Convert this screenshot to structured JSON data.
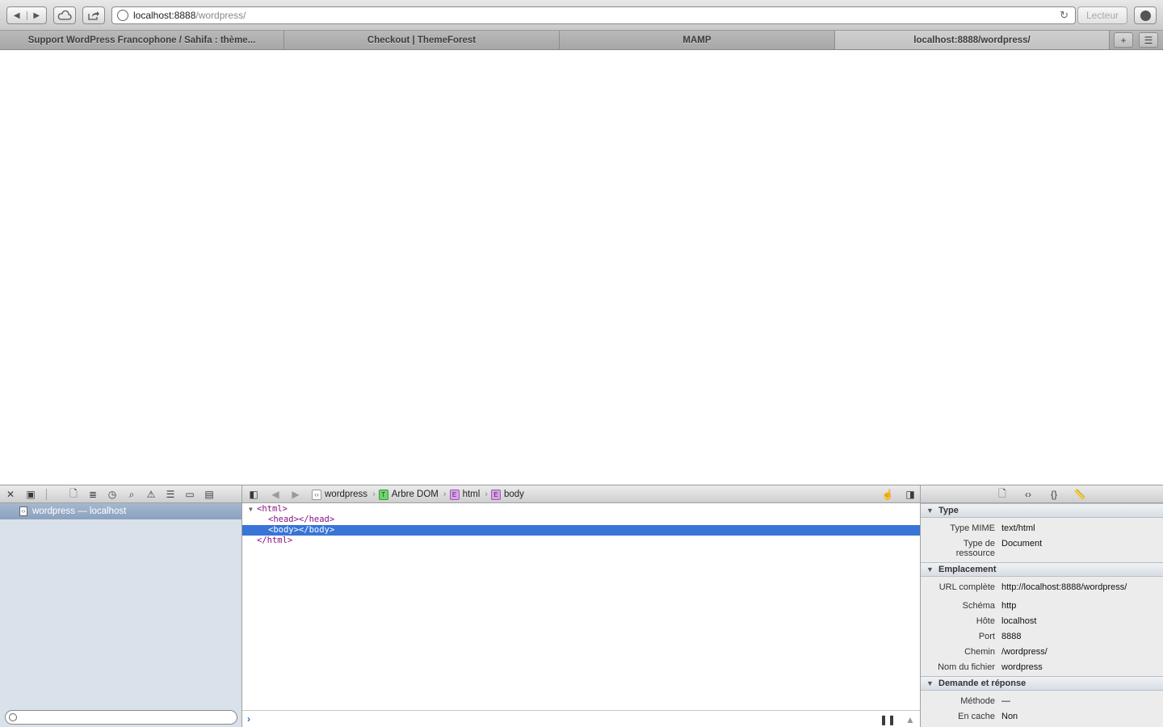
{
  "toolbar": {
    "back_icon": "◀",
    "forward_icon": "▶",
    "url_host": "localhost:8888",
    "url_path": "/wordpress/",
    "reader_label": "Lecteur"
  },
  "tabs": [
    {
      "label": "Support WordPress Francophone / Sahifa : thème..."
    },
    {
      "label": "Checkout | ThemeForest"
    },
    {
      "label": "MAMP"
    },
    {
      "label": "localhost:8888/wordpress/"
    }
  ],
  "inspector": {
    "breadcrumbs": [
      {
        "label": "wordpress",
        "icon": "document-icon"
      },
      {
        "label": "Arbre DOM",
        "icon": "dom-tree-icon"
      },
      {
        "label": "html",
        "icon": "element-icon"
      },
      {
        "label": "body",
        "icon": "element-icon"
      }
    ],
    "resource_item": "wordpress — localhost",
    "dom_lines": [
      "<html>",
      "<head></head>",
      "<body></body>",
      "</html>"
    ],
    "console_prompt": "›",
    "details": {
      "type_section": "Type",
      "mime_label": "Type MIME",
      "mime_value": "text/html",
      "resource_type_label_1": "Type de",
      "resource_type_label_2": "ressource",
      "resource_type_value": "Document",
      "location_section": "Emplacement",
      "full_url_label": "URL complète",
      "full_url_value": "http://localhost:8888/wordpress/",
      "scheme_label": "Schéma",
      "scheme_value": "http",
      "host_label": "Hôte",
      "host_value": "localhost",
      "port_label": "Port",
      "port_value": "8888",
      "path_label": "Chemin",
      "path_value": "/wordpress/",
      "filename_label": "Nom du fichier",
      "filename_value": "wordpress",
      "request_section": "Demande et réponse",
      "method_label": "Méthode",
      "method_value": "—",
      "cache_label": "En cache",
      "cache_value": "Non"
    }
  },
  "colors": {
    "selection": "#3875d7",
    "tag": "#881280",
    "sidebar": "#d9e1ea"
  }
}
